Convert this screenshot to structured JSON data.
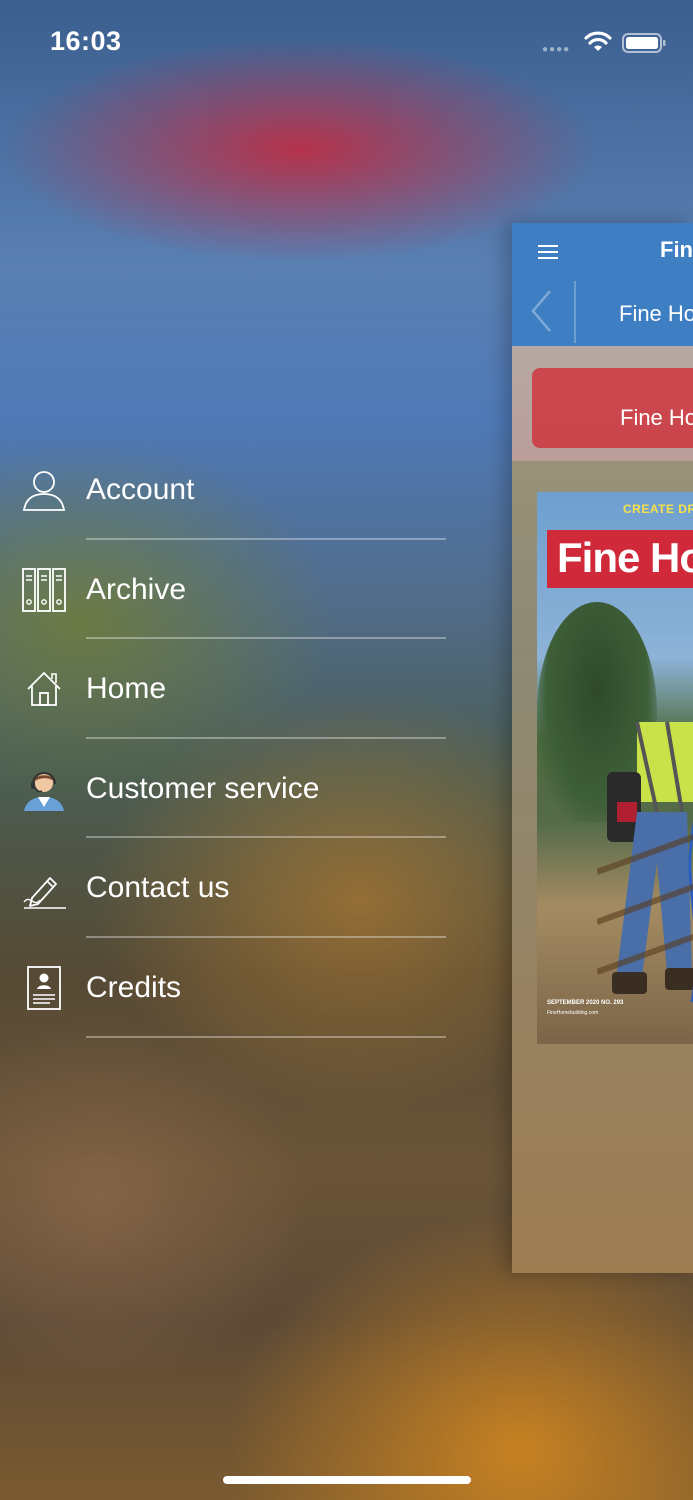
{
  "status_bar": {
    "time": "16:03"
  },
  "menu": {
    "items": [
      {
        "label": "Account",
        "icon": "person-icon"
      },
      {
        "label": "Archive",
        "icon": "binders-icon"
      },
      {
        "label": "Home",
        "icon": "house-icon"
      },
      {
        "label": "Customer service",
        "icon": "support-agent-icon"
      },
      {
        "label": "Contact us",
        "icon": "pen-signature-icon"
      },
      {
        "label": "Credits",
        "icon": "id-card-icon"
      }
    ]
  },
  "preview": {
    "brand": "Fine",
    "nav_title": "Fine Ho",
    "subhead_title": "Fine Ho",
    "cover": {
      "top_tag": "CREATE DR",
      "masthead": "Fine Ho",
      "issue": "SEPTEMBER 2020 NO. 293",
      "site": "FineHomebuilding.com"
    }
  },
  "colors": {
    "nav_blue": "#3d7fc2",
    "masthead_red": "#d02a3a",
    "cover_tag_yellow": "#f6e04b"
  }
}
